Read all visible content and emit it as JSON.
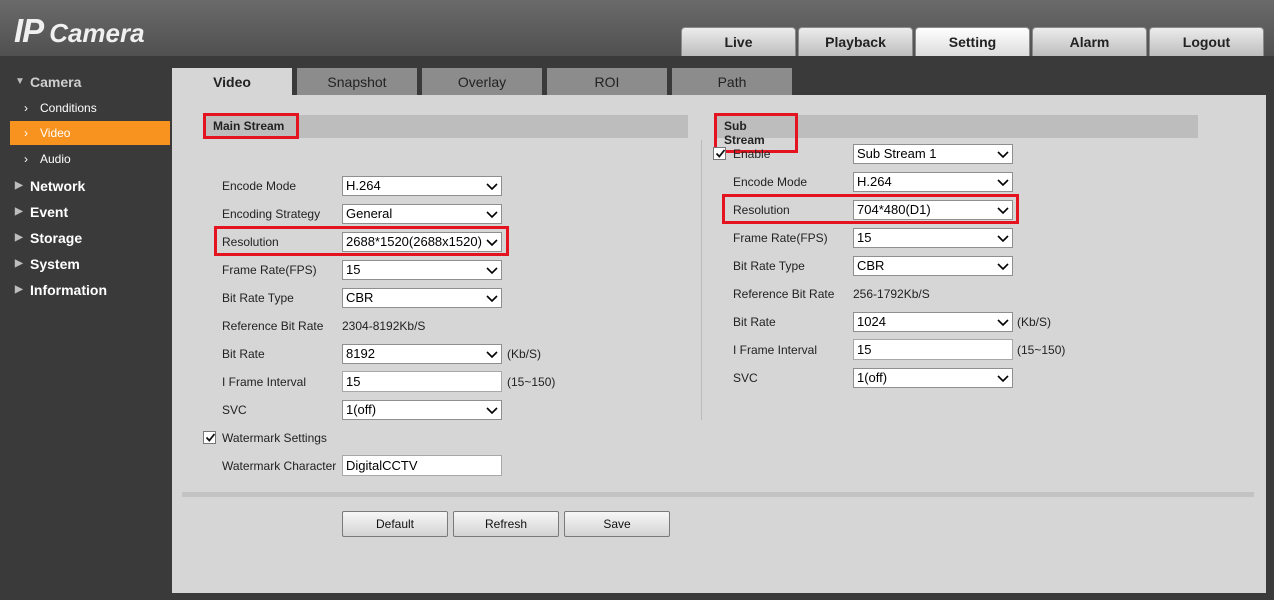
{
  "app": {
    "logo_ip": "IP",
    "logo_camera": "Camera"
  },
  "top_tabs": [
    {
      "label": "Live"
    },
    {
      "label": "Playback"
    },
    {
      "label": "Setting",
      "active": true
    },
    {
      "label": "Alarm"
    },
    {
      "label": "Logout"
    }
  ],
  "sidebar": {
    "camera": "Camera",
    "conditions": "Conditions",
    "video": "Video",
    "audio": "Audio",
    "network": "Network",
    "event": "Event",
    "storage": "Storage",
    "system": "System",
    "information": "Information"
  },
  "sub_tabs": [
    {
      "label": "Video",
      "active": true
    },
    {
      "label": "Snapshot"
    },
    {
      "label": "Overlay"
    },
    {
      "label": "ROI"
    },
    {
      "label": "Path"
    }
  ],
  "main_stream": {
    "title": "Main Stream",
    "encode_mode_label": "Encode Mode",
    "encode_mode": "H.264",
    "encoding_strategy_label": "Encoding Strategy",
    "encoding_strategy": "General",
    "resolution_label": "Resolution",
    "resolution": "2688*1520(2688x1520)",
    "frame_rate_label": "Frame Rate(FPS)",
    "frame_rate": "15",
    "bit_rate_type_label": "Bit Rate Type",
    "bit_rate_type": "CBR",
    "reference_bit_rate_label": "Reference Bit Rate",
    "reference_bit_rate": "2304-8192Kb/S",
    "bit_rate_label": "Bit Rate",
    "bit_rate": "8192",
    "bit_rate_unit": "(Kb/S)",
    "i_frame_label": "I Frame Interval",
    "i_frame": "15",
    "i_frame_range": "(15~150)",
    "svc_label": "SVC",
    "svc": "1(off)",
    "watermark_settings_label": "Watermark Settings",
    "watermark_character_label": "Watermark Character",
    "watermark_character": "DigitalCCTV"
  },
  "sub_stream": {
    "title": "Sub Stream",
    "enable_label": "Enable",
    "enable_value": "Sub Stream 1",
    "encode_mode_label": "Encode Mode",
    "encode_mode": "H.264",
    "resolution_label": "Resolution",
    "resolution": "704*480(D1)",
    "frame_rate_label": "Frame Rate(FPS)",
    "frame_rate": "15",
    "bit_rate_type_label": "Bit Rate Type",
    "bit_rate_type": "CBR",
    "reference_bit_rate_label": "Reference Bit Rate",
    "reference_bit_rate": "256-1792Kb/S",
    "bit_rate_label": "Bit Rate",
    "bit_rate": "1024",
    "bit_rate_unit": "(Kb/S)",
    "i_frame_label": "I Frame Interval",
    "i_frame": "15",
    "i_frame_range": "(15~150)",
    "svc_label": "SVC",
    "svc": "1(off)"
  },
  "buttons": {
    "default": "Default",
    "refresh": "Refresh",
    "save": "Save"
  },
  "colors": {
    "accent": "#f7931e",
    "highlight": "#e3141f",
    "panel": "#d6d6d6"
  }
}
